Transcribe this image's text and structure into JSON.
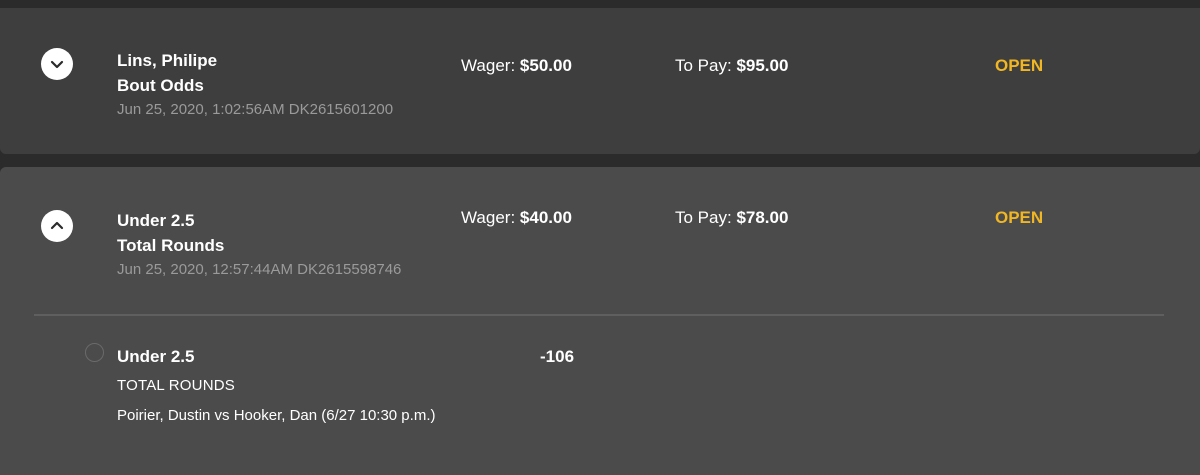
{
  "bets": [
    {
      "selection": "Lins, Philipe",
      "market": "Bout Odds",
      "meta": "Jun 25, 2020, 1:02:56AM DK2615601200",
      "wager_label": "Wager:",
      "wager_amount": "$50.00",
      "topay_label": "To Pay:",
      "topay_amount": "$95.00",
      "status": "OPEN",
      "toggle_icon": "chevron-down-icon"
    },
    {
      "selection": "Under 2.5",
      "market": "Total Rounds",
      "meta": "Jun 25, 2020, 12:57:44AM DK2615598746",
      "wager_label": "Wager:",
      "wager_amount": "$40.00",
      "topay_label": "To Pay:",
      "topay_amount": "$78.00",
      "status": "OPEN",
      "toggle_icon": "chevron-up-icon",
      "leg": {
        "selection": "Under 2.5",
        "market": "TOTAL ROUNDS",
        "event": "Poirier, Dustin vs Hooker, Dan (6/27 10:30 p.m.)",
        "odds": "-106"
      }
    }
  ],
  "colors": {
    "status_open": "#f0b623",
    "card_background": "#3e3e3e",
    "expanded_card_background": "#4b4b4b",
    "meta_text": "#9a9a9a"
  }
}
